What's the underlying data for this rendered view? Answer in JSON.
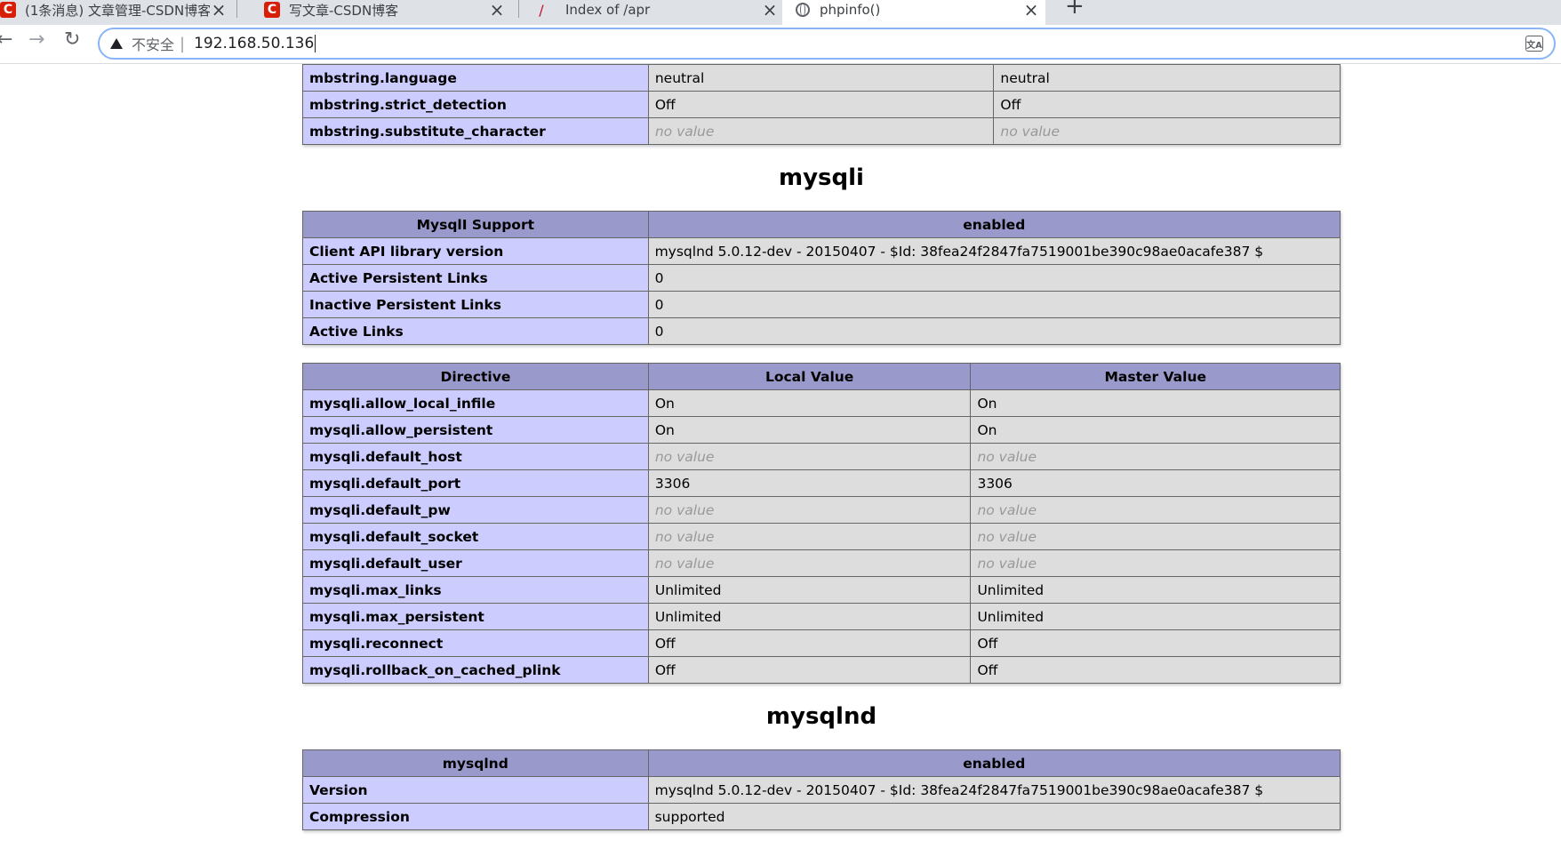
{
  "browser": {
    "tabs": [
      {
        "title": "(1条消息) 文章管理-CSDN博客",
        "favicon": "csdn-icon",
        "active": false
      },
      {
        "title": "写文章-CSDN博客",
        "favicon": "csdn-icon",
        "active": false
      },
      {
        "title": "Index of /apr",
        "favicon": "apache-feather-icon",
        "active": false
      },
      {
        "title": "phpinfo()",
        "favicon": "globe-icon",
        "active": true
      }
    ],
    "favicon_letter": "C",
    "security_label": "不安全",
    "url": "192.168.50.136"
  },
  "mbstring_tail": {
    "rows": [
      {
        "directive": "mbstring.language",
        "local": "neutral",
        "master": "neutral"
      },
      {
        "directive": "mbstring.strict_detection",
        "local": "Off",
        "master": "Off"
      },
      {
        "directive": "mbstring.substitute_character",
        "local": "no value",
        "master": "no value"
      }
    ]
  },
  "mysqli": {
    "heading": "mysqli",
    "info": {
      "header": [
        "MysqlI Support",
        "enabled"
      ],
      "rows": [
        [
          "Client API library version",
          "mysqlnd 5.0.12-dev - 20150407 - $Id: 38fea24f2847fa7519001be390c98ae0acafe387 $"
        ],
        [
          "Active Persistent Links",
          "0"
        ],
        [
          "Inactive Persistent Links",
          "0"
        ],
        [
          "Active Links",
          "0"
        ]
      ]
    },
    "directives": {
      "header": [
        "Directive",
        "Local Value",
        "Master Value"
      ],
      "rows": [
        {
          "directive": "mysqli.allow_local_infile",
          "local": "On",
          "master": "On"
        },
        {
          "directive": "mysqli.allow_persistent",
          "local": "On",
          "master": "On"
        },
        {
          "directive": "mysqli.default_host",
          "local": "no value",
          "master": "no value"
        },
        {
          "directive": "mysqli.default_port",
          "local": "3306",
          "master": "3306"
        },
        {
          "directive": "mysqli.default_pw",
          "local": "no value",
          "master": "no value"
        },
        {
          "directive": "mysqli.default_socket",
          "local": "no value",
          "master": "no value"
        },
        {
          "directive": "mysqli.default_user",
          "local": "no value",
          "master": "no value"
        },
        {
          "directive": "mysqli.max_links",
          "local": "Unlimited",
          "master": "Unlimited"
        },
        {
          "directive": "mysqli.max_persistent",
          "local": "Unlimited",
          "master": "Unlimited"
        },
        {
          "directive": "mysqli.reconnect",
          "local": "Off",
          "master": "Off"
        },
        {
          "directive": "mysqli.rollback_on_cached_plink",
          "local": "Off",
          "master": "Off"
        }
      ]
    }
  },
  "mysqlnd": {
    "heading": "mysqlnd",
    "info": {
      "header": [
        "mysqlnd",
        "enabled"
      ],
      "rows": [
        [
          "Version",
          "mysqlnd 5.0.12-dev - 20150407 - $Id: 38fea24f2847fa7519001be390c98ae0acafe387 $"
        ],
        [
          "Compression",
          "supported"
        ]
      ]
    }
  }
}
